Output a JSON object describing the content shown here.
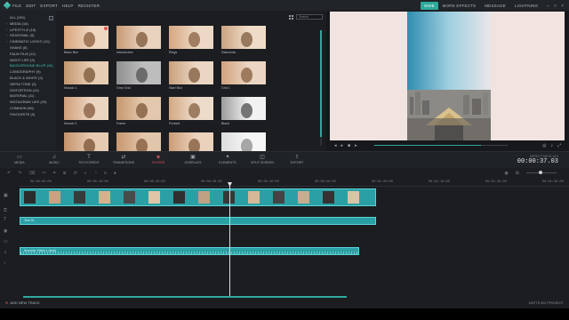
{
  "menubar": {
    "menus": [
      "FILE",
      "EDIT",
      "EXPORT",
      "HELP",
      "REGISTER"
    ],
    "save": "SAVE",
    "more_effects": "MORE EFFECTS",
    "message": "MESSAGE",
    "lightning": "LIGHTNING"
  },
  "categories": [
    {
      "label": "ALL (261)",
      "arrow": false
    },
    {
      "label": "MEDIA (16)",
      "arrow": true
    },
    {
      "label": "LIFESTYLE (18)",
      "arrow": true
    },
    {
      "label": "SEASONAL (9)",
      "arrow": true
    },
    {
      "label": "CINEMATIC LOOKS (10)",
      "arrow": true
    },
    {
      "label": "SHAKE (6)",
      "arrow": false
    },
    {
      "label": "FALM FILM (12)",
      "arrow": false
    },
    {
      "label": "NIGHT LIFE (3)",
      "arrow": false
    },
    {
      "label": "BACKGROUND BLUR (16)",
      "arrow": false,
      "active": true
    },
    {
      "label": "LOMOGRAPHY (9)",
      "arrow": false
    },
    {
      "label": "BLACK & WHITE (3)",
      "arrow": false
    },
    {
      "label": "SEPIA TONE (3)",
      "arrow": false
    },
    {
      "label": "DISTORTION (10)",
      "arrow": false
    },
    {
      "label": "MATERIAL (11)",
      "arrow": false
    },
    {
      "label": "INSTAGRAM LIKE (29)",
      "arrow": false
    },
    {
      "label": "COMMON (96)",
      "arrow": false
    },
    {
      "label": "FAVOURITE (0)",
      "arrow": false
    }
  ],
  "search": {
    "placeholder": "Search"
  },
  "thumbnails": [
    {
      "name": "Basic Blur",
      "badge": true
    },
    {
      "name": "Intersection",
      "badge": false
    },
    {
      "name": "Rings",
      "badge": false
    },
    {
      "name": "Diamonds",
      "badge": false
    },
    {
      "name": "Mosaic 1",
      "badge": false
    },
    {
      "name": "Grey Grid",
      "badge": false
    },
    {
      "name": "Start Blur",
      "badge": false
    },
    {
      "name": "Grid 1",
      "badge": false
    },
    {
      "name": "Mosaic 2",
      "badge": false
    },
    {
      "name": "Frame",
      "badge": false
    },
    {
      "name": "Frosted",
      "badge": false
    },
    {
      "name": "Black",
      "badge": false
    },
    {
      "name": "",
      "badge": false
    },
    {
      "name": "",
      "badge": false
    },
    {
      "name": "",
      "badge": false
    },
    {
      "name": "",
      "badge": false
    }
  ],
  "preview": {
    "time": "00:00:37.03"
  },
  "toolbox": [
    {
      "label": "MEDIA",
      "icon": "folder-icon"
    },
    {
      "label": "MUSIC",
      "icon": "music-icon"
    },
    {
      "label": "TEXT/CREDIT",
      "icon": "text-icon"
    },
    {
      "label": "TRANSITIONS",
      "icon": "transitions-icon"
    },
    {
      "label": "FILTERS",
      "icon": "filters-icon",
      "active": true
    },
    {
      "label": "OVERLAYS",
      "icon": "overlays-icon"
    },
    {
      "label": "ELEMENTS",
      "icon": "elements-icon"
    },
    {
      "label": "SPLIT SCREEN",
      "icon": "split-screen-icon"
    },
    {
      "label": "EXPORT",
      "icon": "export-icon"
    }
  ],
  "timecode": {
    "label": "ASPECT RATIO 16:9",
    "value": "00:00:37.03"
  },
  "ruler": [
    "00:00:00:00",
    "00:00:10:00",
    "00:00:20:00",
    "00:00:30:00",
    "00:00:40:00",
    "00:00:50:00",
    "00:01:00:00",
    "00:01:10:00",
    "00:01:20:00",
    "00:01:30:00"
  ],
  "clips": {
    "video_label": "",
    "text_label": "Text 01",
    "audio_label": "Summer Vibes 1 (feat)"
  },
  "bottom": {
    "add_track": "ADD NEW TRACK",
    "project": "UNTITLED PROJECT"
  },
  "colors": {
    "accent": "#2fa99c",
    "active_tool": "#e0555f",
    "clip": "#2aa0a5"
  }
}
